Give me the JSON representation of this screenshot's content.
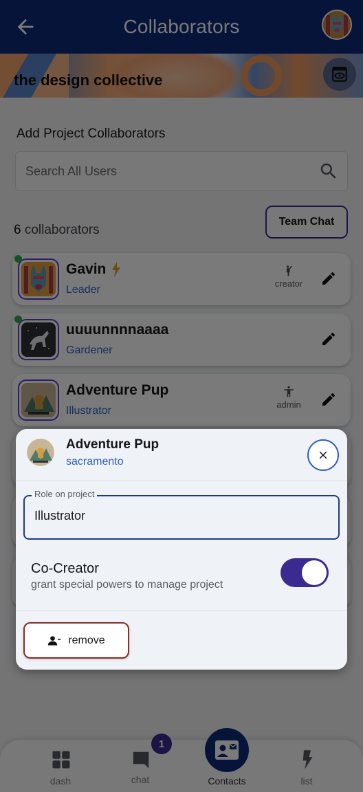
{
  "appbar": {
    "title": "Collaborators",
    "back_icon": "arrow-left-icon",
    "avatar_icon": "user-avatar"
  },
  "banner": {
    "project_name": "the design collective",
    "view_icon": "preview-eye-icon"
  },
  "add_section": {
    "title": "Add Project Collaborators",
    "search_placeholder": "Search All Users",
    "search_value": "",
    "search_icon": "search-icon"
  },
  "collaborators": {
    "count": "6",
    "count_label": "collaborators",
    "team_chat_label": "Team Chat",
    "items": [
      {
        "name": "Gavin",
        "role": "Leader",
        "online": true,
        "badge_icon": "lightning-icon",
        "permission": "creator",
        "permission_icon": "person-waving-icon",
        "avatar_color": "#d79a3a"
      },
      {
        "name": "uuuunnnnaaaa",
        "role": "Gardener",
        "online": true,
        "badge_icon": "",
        "permission": "",
        "permission_icon": "",
        "avatar_color": "#2e3036"
      },
      {
        "name": "Adventure Pup",
        "role": "Illustrator",
        "online": false,
        "badge_icon": "",
        "permission": "admin",
        "permission_icon": "accessibility-person-icon",
        "avatar_color": "#c8b595"
      }
    ]
  },
  "modal": {
    "name": "Adventure Pup",
    "location": "sacramento",
    "role_label": "Role on project",
    "role_value": "Illustrator",
    "cocreator_title": "Co-Creator",
    "cocreator_subtitle": "grant special powers to manage project",
    "cocreator_enabled": true,
    "remove_label": "remove"
  },
  "bottom_nav": {
    "items": [
      {
        "label": "dash",
        "icon": "dashboard-grid-icon",
        "active": false
      },
      {
        "label": "chat",
        "icon": "chat-bubble-icon",
        "active": false,
        "badge": "1"
      },
      {
        "label": "Contacts",
        "icon": "contact-card-icon",
        "active": true
      },
      {
        "label": "list",
        "icon": "lightning-icon",
        "active": false
      }
    ]
  },
  "colors": {
    "primary": "#0f2a78",
    "accent": "#3b2a8f",
    "link": "#2c5fc9",
    "danger": "#8a2e25",
    "online": "#2fa84f"
  }
}
